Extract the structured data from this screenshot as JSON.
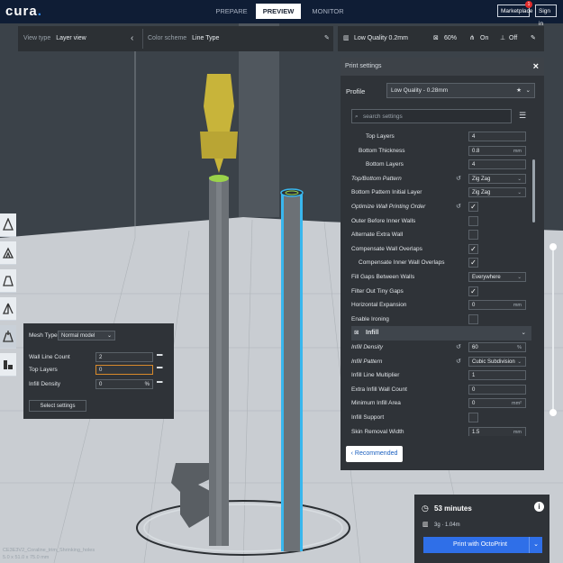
{
  "app": {
    "logo": "cura",
    "logo_dot": "."
  },
  "stages": {
    "prepare": "PREPARE",
    "preview": "PREVIEW",
    "monitor": "MONITOR"
  },
  "account": {
    "marketplace": "Marketplace",
    "signin": "Sign in",
    "notification_count": "1"
  },
  "view_bar": {
    "view_type_label": "View type",
    "view_type_value": "Layer view",
    "color_scheme_label": "Color scheme",
    "color_scheme_value": "Line Type"
  },
  "print_bar": {
    "profile": "Low Quality 0.2mm",
    "infill": "60%",
    "support": "On",
    "adhesion": "Off"
  },
  "settings_panel": {
    "title": "Print settings",
    "profile_label": "Profile",
    "profile_value": "Low Quality - 0.28mm",
    "search_placeholder": "search settings",
    "recommended": "Recommended",
    "rows": [
      {
        "label": "Top Layers",
        "indent": 2,
        "value": "4",
        "unit": ""
      },
      {
        "label": "Bottom Thickness",
        "indent": 1,
        "value": "0.8",
        "unit": "mm"
      },
      {
        "label": "Bottom Layers",
        "indent": 2,
        "value": "4",
        "unit": ""
      },
      {
        "label": "Top/Bottom Pattern",
        "indent": 0,
        "value": "Zig Zag",
        "unit": "",
        "italic": true,
        "reset": true,
        "dropdown": true
      },
      {
        "label": "Bottom Pattern Initial Layer",
        "indent": 0,
        "value": "Zig Zag",
        "unit": "",
        "dropdown": true
      },
      {
        "label": "Optimize Wall Printing Order",
        "indent": 0,
        "check": true,
        "italic": true,
        "reset": true
      },
      {
        "label": "Outer Before Inner Walls",
        "indent": 0,
        "check": false
      },
      {
        "label": "Alternate Extra Wall",
        "indent": 0,
        "check": false
      },
      {
        "label": "Compensate Wall Overlaps",
        "indent": 0,
        "check": true
      },
      {
        "label": "Compensate Inner Wall Overlaps",
        "indent": 1,
        "check": true
      },
      {
        "label": "Fill Gaps Between Walls",
        "indent": 0,
        "value": "Everywhere",
        "unit": "",
        "dropdown": true
      },
      {
        "label": "Filter Out Tiny Gaps",
        "indent": 0,
        "check": true
      },
      {
        "label": "Horizontal Expansion",
        "indent": 0,
        "value": "0",
        "unit": "mm"
      },
      {
        "label": "Enable Ironing",
        "indent": 0,
        "check": false
      },
      {
        "label": "Infill",
        "indent": 0,
        "category": true
      },
      {
        "label": "Infill Density",
        "indent": 0,
        "value": "60",
        "unit": "%",
        "italic": true,
        "reset": true
      },
      {
        "label": "Infill Pattern",
        "indent": 0,
        "value": "Cubic Subdivision",
        "unit": "",
        "italic": true,
        "reset": true,
        "dropdown": true
      },
      {
        "label": "Infill Line Multiplier",
        "indent": 0,
        "value": "1",
        "unit": ""
      },
      {
        "label": "Extra Infill Wall Count",
        "indent": 0,
        "value": "0",
        "unit": ""
      },
      {
        "label": "Minimum Infill Area",
        "indent": 0,
        "value": "0",
        "unit": "mm²"
      },
      {
        "label": "Infill Support",
        "indent": 0,
        "check": false
      },
      {
        "label": "Skin Removal Width",
        "indent": 0,
        "value": "1.5",
        "unit": "mm"
      }
    ]
  },
  "per_model": {
    "mesh_type_label": "Mesh Type",
    "mesh_type_value": "Normal model",
    "wall_line_count_label": "Wall Line Count",
    "wall_line_count_value": "2",
    "top_layers_label": "Top Layers",
    "top_layers_value": "0",
    "infill_density_label": "Infill Density",
    "infill_density_value": "0",
    "infill_density_unit": "%",
    "select_settings": "Select settings"
  },
  "job": {
    "time": "53 minutes",
    "material": "3g · 1.04m",
    "print_button": "Print with OctoPrint"
  },
  "model_info": {
    "name": "CE3E3V2_Coraline_trim_Shrinking_holes",
    "dims": "5.0 x 51.0 x 75.0 mm"
  },
  "colors": {
    "accent": "#2f6fe8",
    "topbar": "#0f1d35",
    "panel": "#2f3338"
  }
}
